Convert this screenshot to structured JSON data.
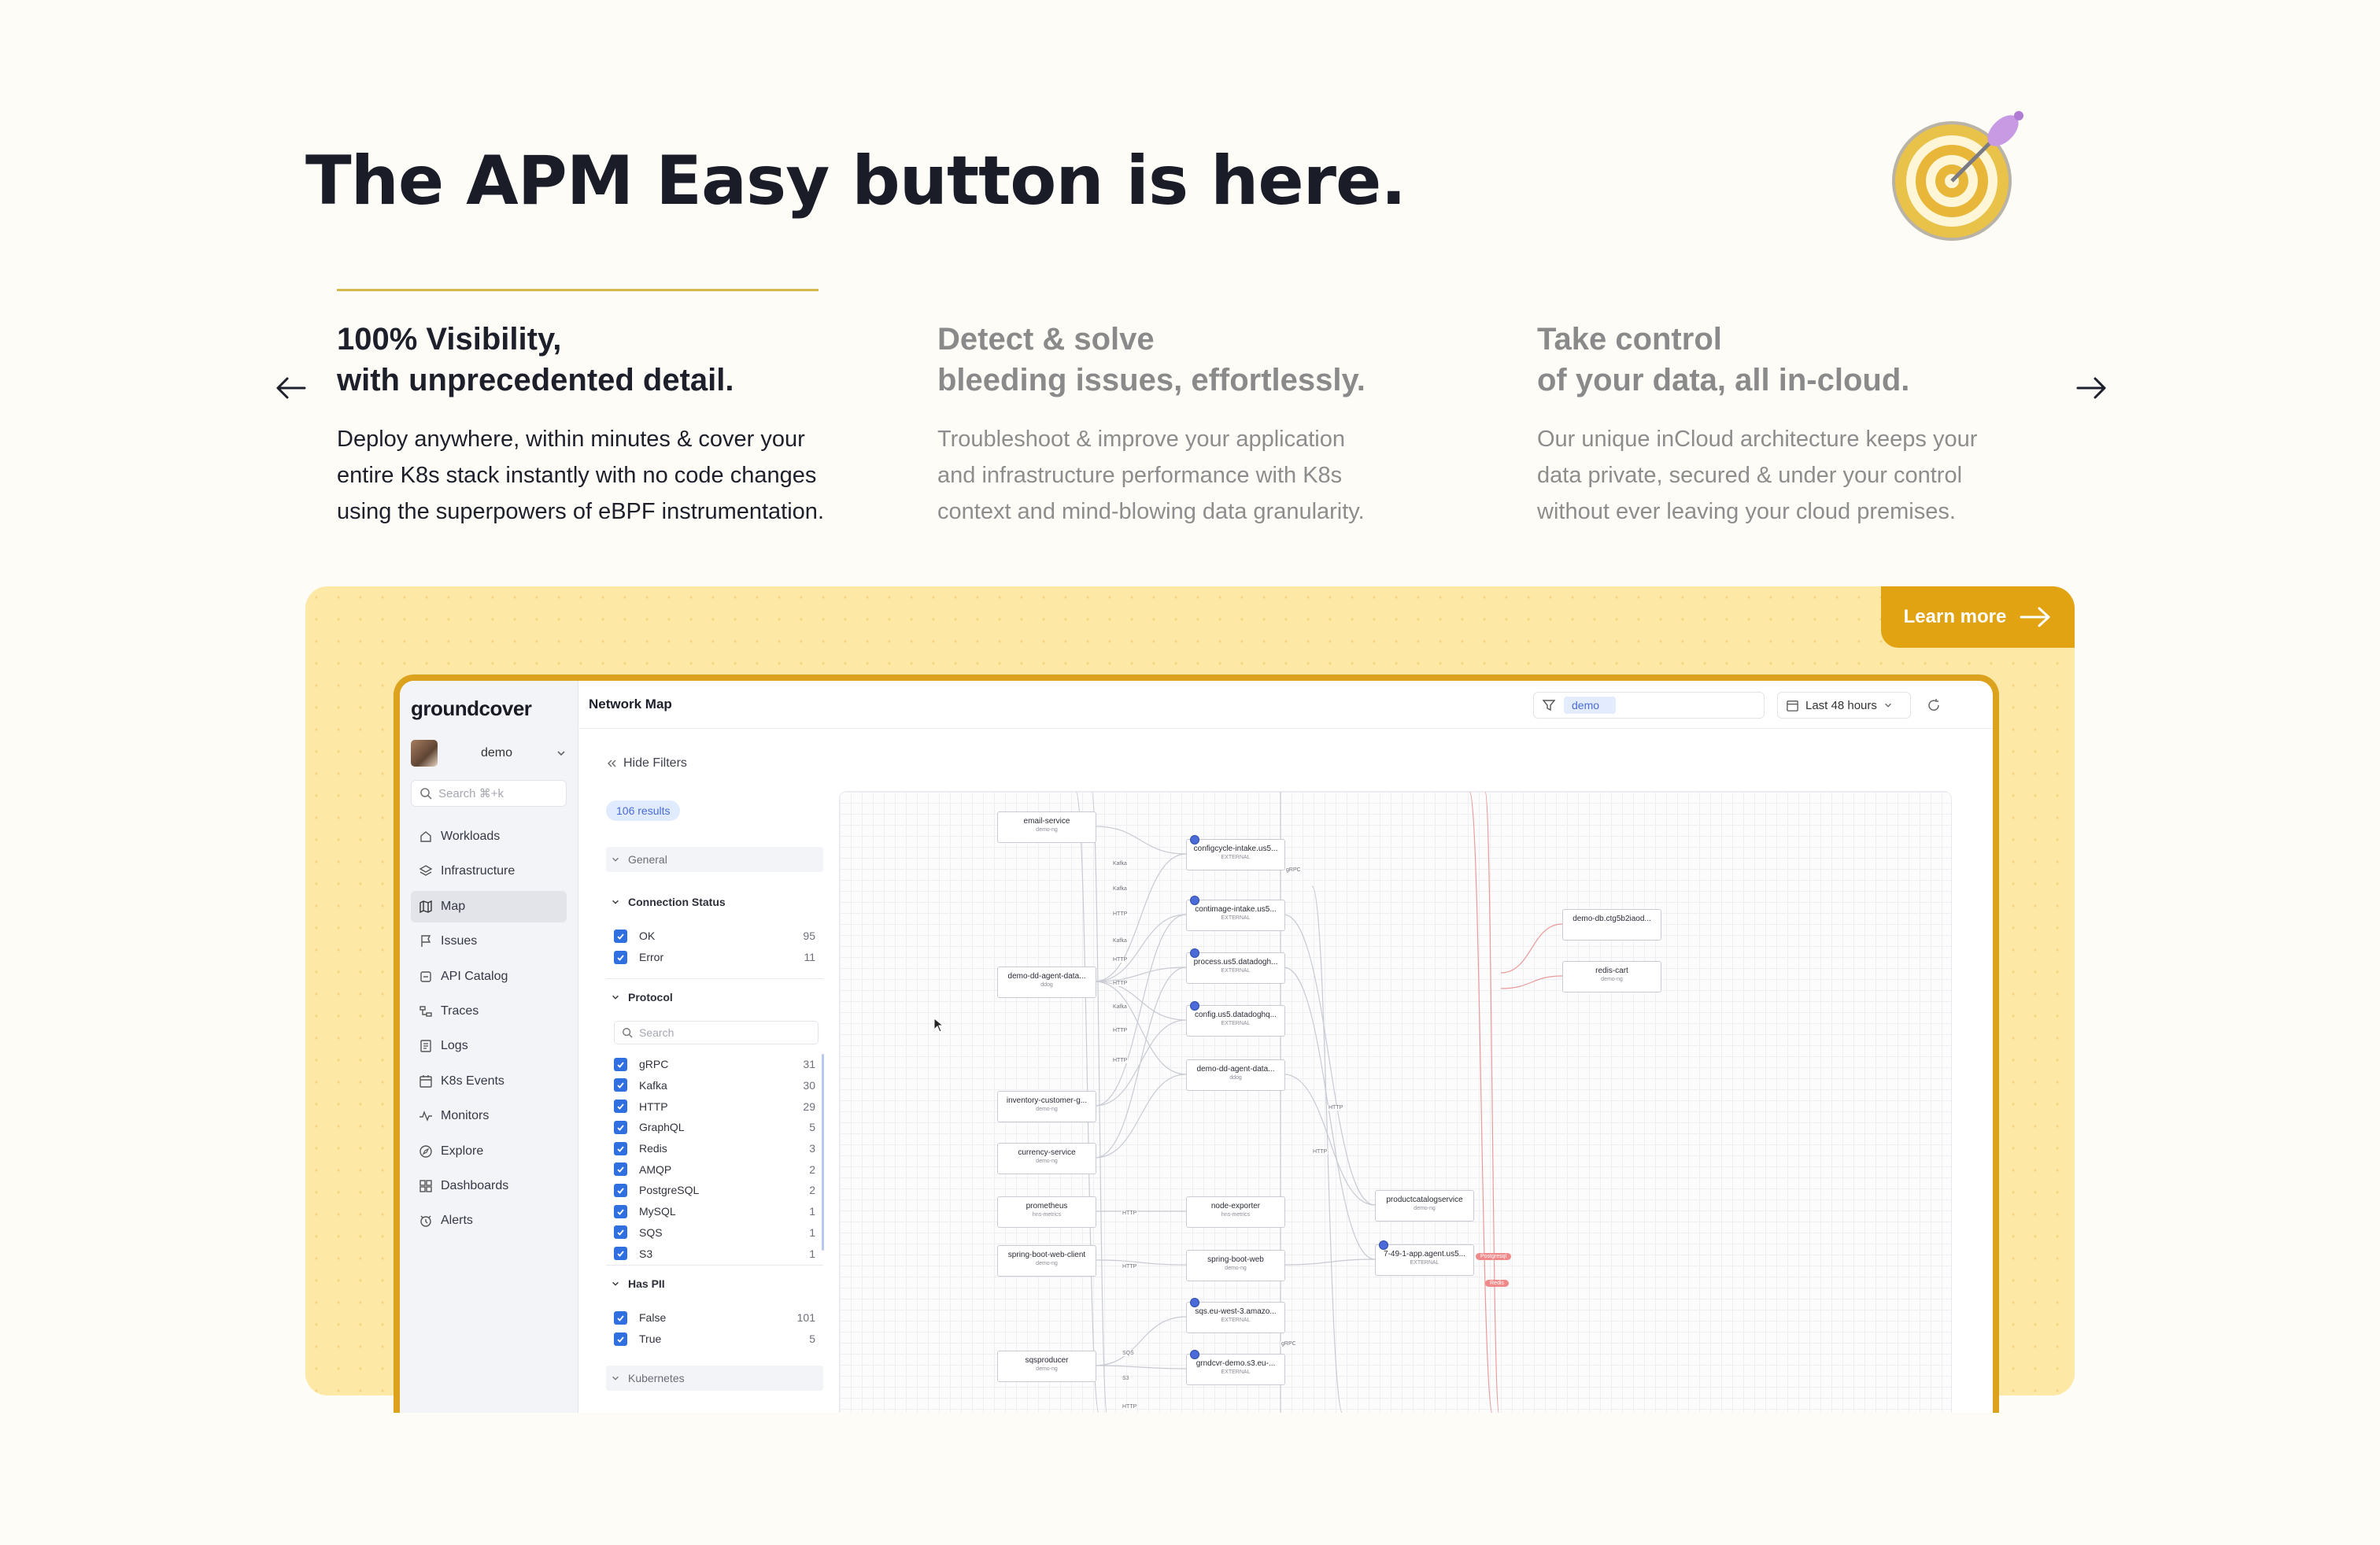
{
  "headline": "The APM Easy button is here.",
  "features": [
    {
      "title_line1": "100% Visibility,",
      "title_line2": "with unprecedented detail.",
      "body_line1": "Deploy anywhere, within minutes & cover your",
      "body_line2": "entire K8s stack instantly with no code changes",
      "body_line3": "using the superpowers of eBPF instrumentation."
    },
    {
      "title_line1": "Detect & solve",
      "title_line2": "bleeding issues, effortlessly.",
      "body_line1": "Troubleshoot & improve your application",
      "body_line2": "and infrastructure performance with K8s",
      "body_line3": "context and mind-blowing data granularity."
    },
    {
      "title_line1": "Take control",
      "title_line2": "of your data, all in-cloud.",
      "body_line1": "Our unique inCloud architecture keeps your",
      "body_line2": "data private, secured & under your control",
      "body_line3": "without ever leaving your cloud premises."
    }
  ],
  "icons": {
    "prev": "arrow-left-icon",
    "next": "arrow-right-icon",
    "target": "dartboard-icon"
  },
  "colors": {
    "accent": "#e2a313",
    "frame": "#dca21e",
    "panel_bg": "#fde8a6",
    "checkbox": "#2f6fe0"
  },
  "cta": {
    "label": "Learn more"
  },
  "app": {
    "logo": "groundcover",
    "user": "demo",
    "search_placeholder": "Search ⌘+k",
    "nav": [
      "Workloads",
      "Infrastructure",
      "Map",
      "Issues",
      "API Catalog",
      "Traces",
      "Logs",
      "K8s Events",
      "Monitors",
      "Explore",
      "Dashboards",
      "Alerts"
    ],
    "nav_active": "Map",
    "page_title": "Network Map",
    "filter_chip": "demo",
    "time_range": "Last 48 hours",
    "hide_filters": "Hide Filters",
    "results": "106 results",
    "sections": {
      "general": "General",
      "connection_status": "Connection Status",
      "protocol": "Protocol",
      "has_pii": "Has PII",
      "kubernetes": "Kubernetes"
    },
    "connection_status": [
      {
        "label": "OK",
        "count": "95"
      },
      {
        "label": "Error",
        "count": "11"
      }
    ],
    "protocol_search_placeholder": "Search",
    "protocols": [
      {
        "label": "gRPC",
        "count": "31"
      },
      {
        "label": "Kafka",
        "count": "30"
      },
      {
        "label": "HTTP",
        "count": "29"
      },
      {
        "label": "GraphQL",
        "count": "5"
      },
      {
        "label": "Redis",
        "count": "3"
      },
      {
        "label": "AMQP",
        "count": "2"
      },
      {
        "label": "PostgreSQL",
        "count": "2"
      },
      {
        "label": "MySQL",
        "count": "1"
      },
      {
        "label": "SQS",
        "count": "1"
      },
      {
        "label": "S3",
        "count": "1"
      }
    ],
    "has_pii": [
      {
        "label": "False",
        "count": "101"
      },
      {
        "label": "True",
        "count": "5"
      }
    ],
    "map_nodes": [
      {
        "name": "email-service",
        "ns": "demo-ng"
      },
      {
        "name": "demo-dd-agent-data...",
        "ns": "ddog"
      },
      {
        "name": "inventory-customer-g...",
        "ns": "demo-ng"
      },
      {
        "name": "currency-service",
        "ns": "demo-ng"
      },
      {
        "name": "prometheus",
        "ns": "hns-metrics"
      },
      {
        "name": "spring-boot-web-client",
        "ns": "demo-ng"
      },
      {
        "name": "sqsproducer",
        "ns": "demo-ng"
      },
      {
        "name": "configcycle-intake.us5...",
        "ns": "EXTERNAL"
      },
      {
        "name": "contimage-intake.us5...",
        "ns": "EXTERNAL"
      },
      {
        "name": "process.us5.datadogh...",
        "ns": "EXTERNAL"
      },
      {
        "name": "config.us5.datadoghq...",
        "ns": "EXTERNAL"
      },
      {
        "name": "demo-dd-agent-data...",
        "ns": "ddog"
      },
      {
        "name": "node-exporter",
        "ns": "hns-metrics"
      },
      {
        "name": "spring-boot-web",
        "ns": "demo-ng"
      },
      {
        "name": "sqs.eu-west-3.amazo...",
        "ns": "EXTERNAL"
      },
      {
        "name": "grndcvr-demo.s3.eu-...",
        "ns": "EXTERNAL"
      },
      {
        "name": "productcatalogservice",
        "ns": "demo-ng"
      },
      {
        "name": "7-49-1-app.agent.us5...",
        "ns": "EXTERNAL"
      },
      {
        "name": "demo-db.ctg5b2iaod...",
        "ns": ""
      },
      {
        "name": "redis-cart",
        "ns": "demo-ng"
      }
    ],
    "edge_labels": [
      "Kafka",
      "Kafka",
      "HTTP",
      "Kafka",
      "HTTP",
      "HTTP",
      "Kafka",
      "HTTP",
      "HTTP",
      "gRPC",
      "HTTP",
      "HTTP",
      "HTTP",
      "HTTP",
      "SQS",
      "S3",
      "HTTP",
      "gRPC"
    ],
    "error_pills": [
      "Postgresql",
      "Redis"
    ]
  }
}
